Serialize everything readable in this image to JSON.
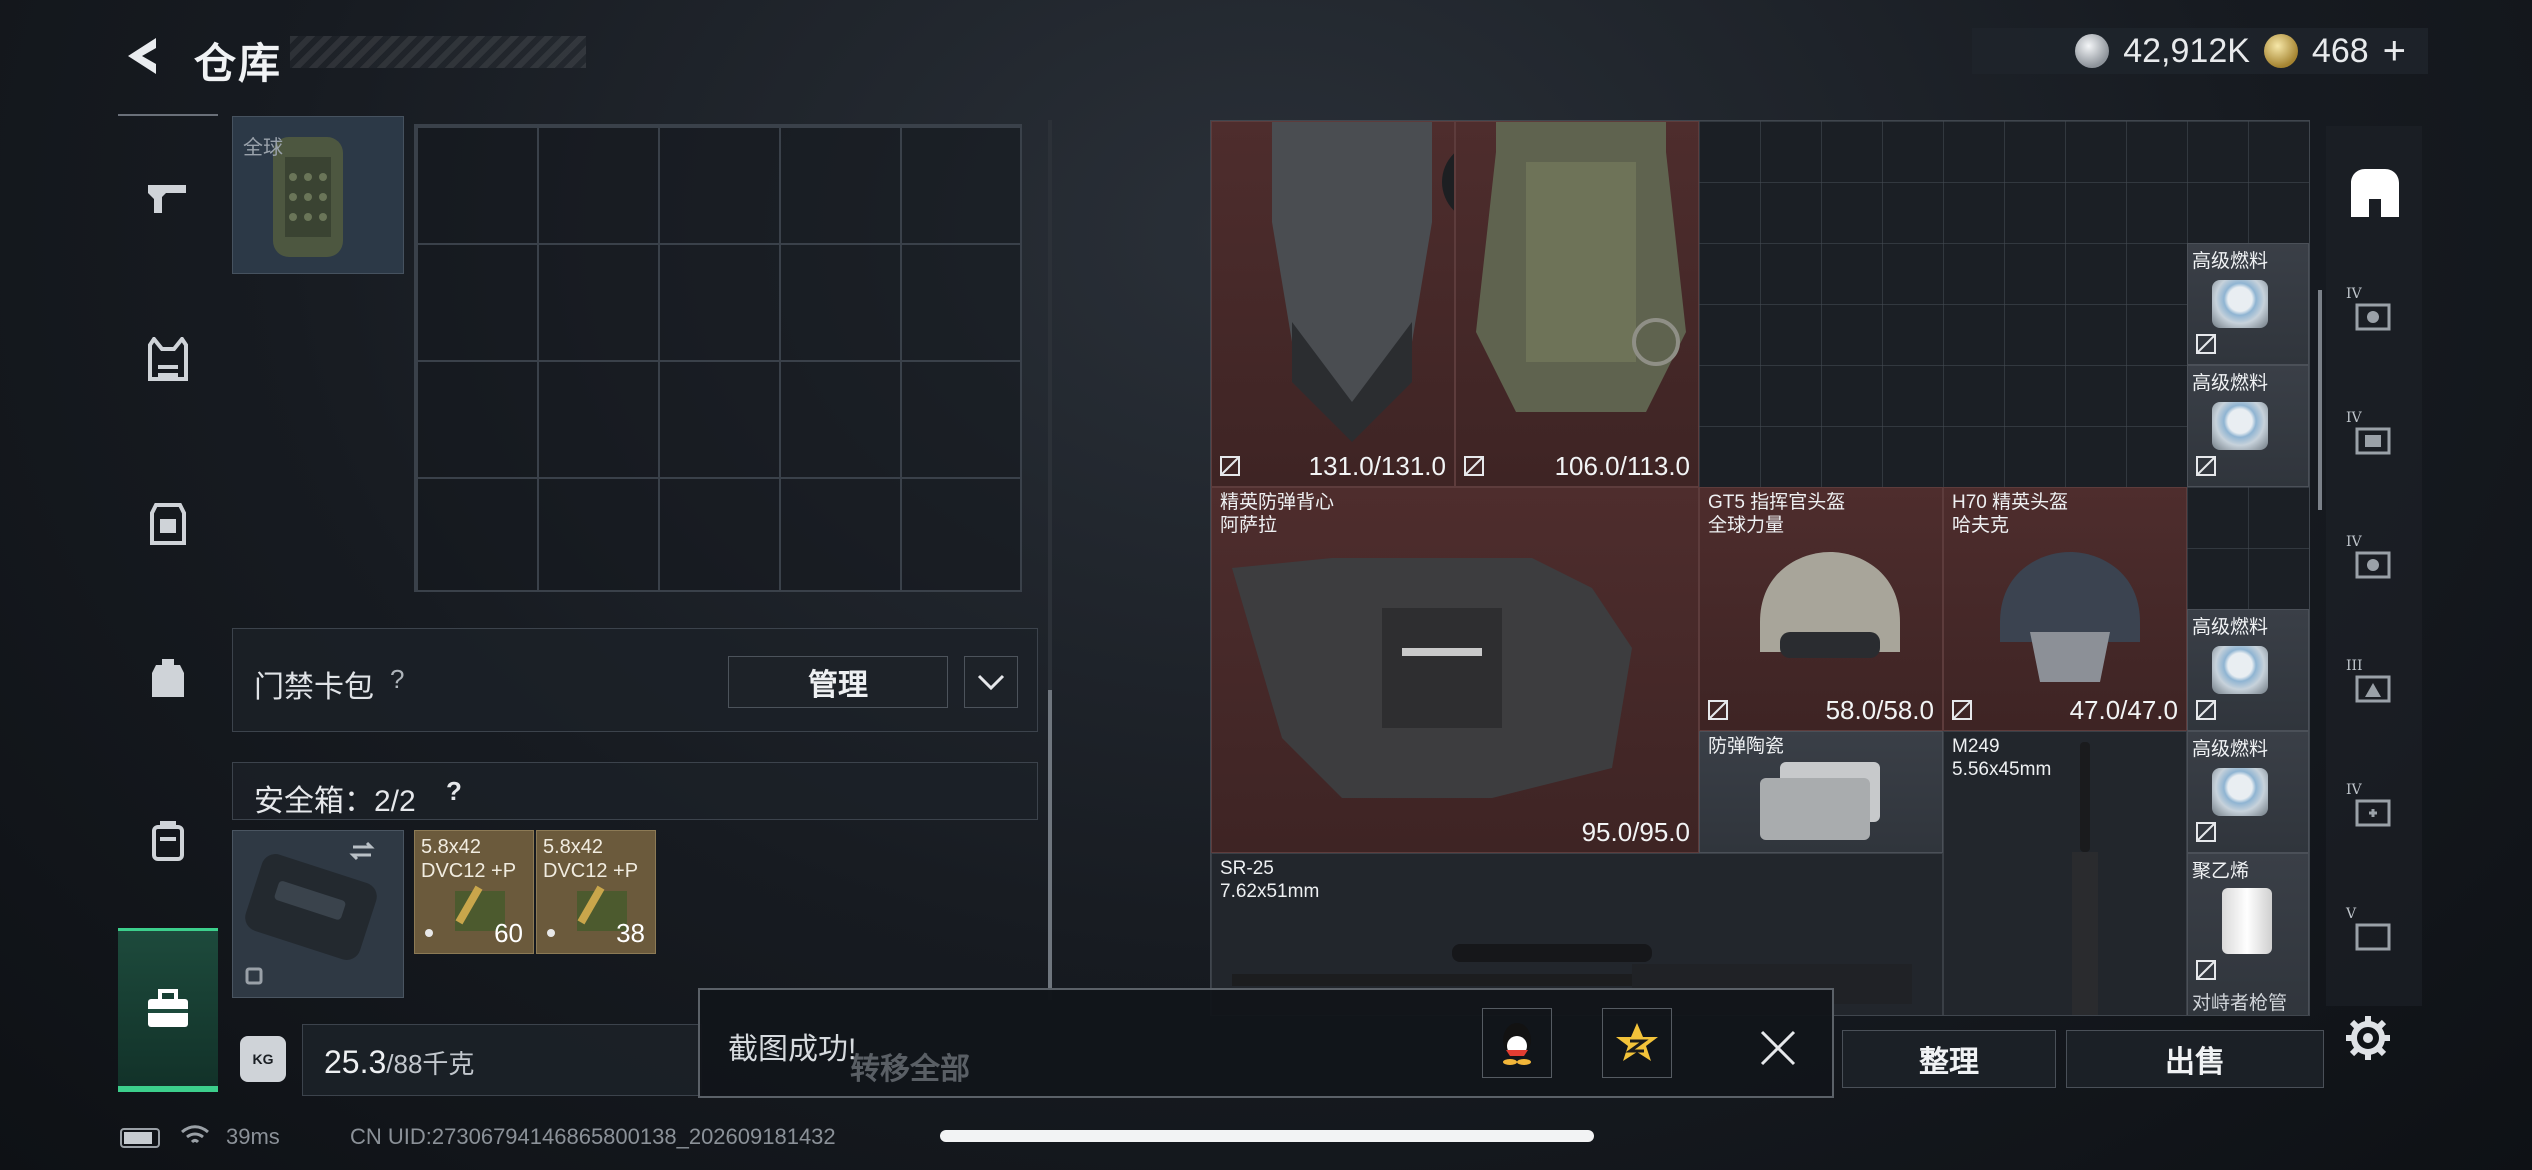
{
  "header": {
    "title": "仓库",
    "currency": [
      {
        "icon": "silver-coin-icon",
        "value": "42,912K"
      },
      {
        "icon": "gold-coin-icon",
        "value": "468",
        "suffix": "+"
      }
    ]
  },
  "left_rail": {
    "items": [
      {
        "icon": "pistol-icon"
      },
      {
        "icon": "vest-icon"
      },
      {
        "icon": "chest-rig-icon"
      },
      {
        "icon": "backpack-icon"
      },
      {
        "icon": "pouch-icon"
      },
      {
        "icon": "toolbox-icon",
        "active": true
      }
    ]
  },
  "backpack": {
    "thumb_label": "全球"
  },
  "keycard": {
    "label": "门禁卡包",
    "help": "?",
    "manage_label": "管理"
  },
  "safe_box": {
    "label": "安全箱：2/2",
    "help": "?",
    "ammo": [
      {
        "name": "5.8x42",
        "sub": "DVC12 +P",
        "count": "60"
      },
      {
        "name": "5.8x42",
        "sub": "DVC12 +P",
        "count": "38"
      }
    ]
  },
  "weight": {
    "value": "25.3",
    "capacity": "/88千克",
    "icon_label": "KG"
  },
  "toast": {
    "text": "截图成功!",
    "transfer_all": "转移全部",
    "share_icons": [
      "qq-icon",
      "qzone-icon"
    ]
  },
  "bottom_actions": {
    "sort_label": "整理",
    "sell_label": "出售"
  },
  "stash": {
    "items": [
      {
        "id": "armor1",
        "name": "",
        "sub": "",
        "durability": "131.0/131.0",
        "color": "red"
      },
      {
        "id": "armor2",
        "name": "",
        "sub": "",
        "durability": "106.0/113.0",
        "color": "red"
      },
      {
        "id": "vest",
        "name": "精英防弹背心",
        "sub": "阿萨拉",
        "durability": "95.0/95.0",
        "color": "red"
      },
      {
        "id": "gt5",
        "name": "GT5 指挥官头盔",
        "sub": "全球力量",
        "durability": "58.0/58.0",
        "color": "red"
      },
      {
        "id": "h70",
        "name": "H70 精英头盔",
        "sub": "哈夫克",
        "durability": "47.0/47.0",
        "color": "red"
      },
      {
        "id": "ceramic",
        "name": "防弹陶瓷",
        "sub": "",
        "durability": "",
        "color": "gray"
      },
      {
        "id": "m249",
        "name": "M249",
        "sub": "5.56x45mm",
        "durability": "",
        "color": "dark"
      },
      {
        "id": "sr25",
        "name": "SR-25",
        "sub": "7.62x51mm",
        "durability": "",
        "color": "dark"
      }
    ],
    "fuel": [
      {
        "name": "高级燃料"
      },
      {
        "name": "高级燃料"
      },
      {
        "name": "高级燃料"
      },
      {
        "name": "高级燃料"
      }
    ],
    "pe": {
      "name": "聚乙烯",
      "footer": "对峙者枪管"
    }
  },
  "right_rail": {
    "tabs": [
      {
        "icon": "all-items-icon",
        "tier": ""
      },
      {
        "icon": "stash-tab-1-icon",
        "tier": "IV"
      },
      {
        "icon": "stash-tab-2-icon",
        "tier": "IV"
      },
      {
        "icon": "stash-tab-3-icon",
        "tier": "IV"
      },
      {
        "icon": "stash-tab-4-icon",
        "tier": "III"
      },
      {
        "icon": "stash-tab-5-icon",
        "tier": "IV"
      },
      {
        "icon": "stash-tab-6-icon",
        "tier": "V"
      }
    ]
  },
  "status_bar": {
    "ping": "39ms",
    "uid": "CN UID:2730679414686580013​8_202609181432"
  }
}
